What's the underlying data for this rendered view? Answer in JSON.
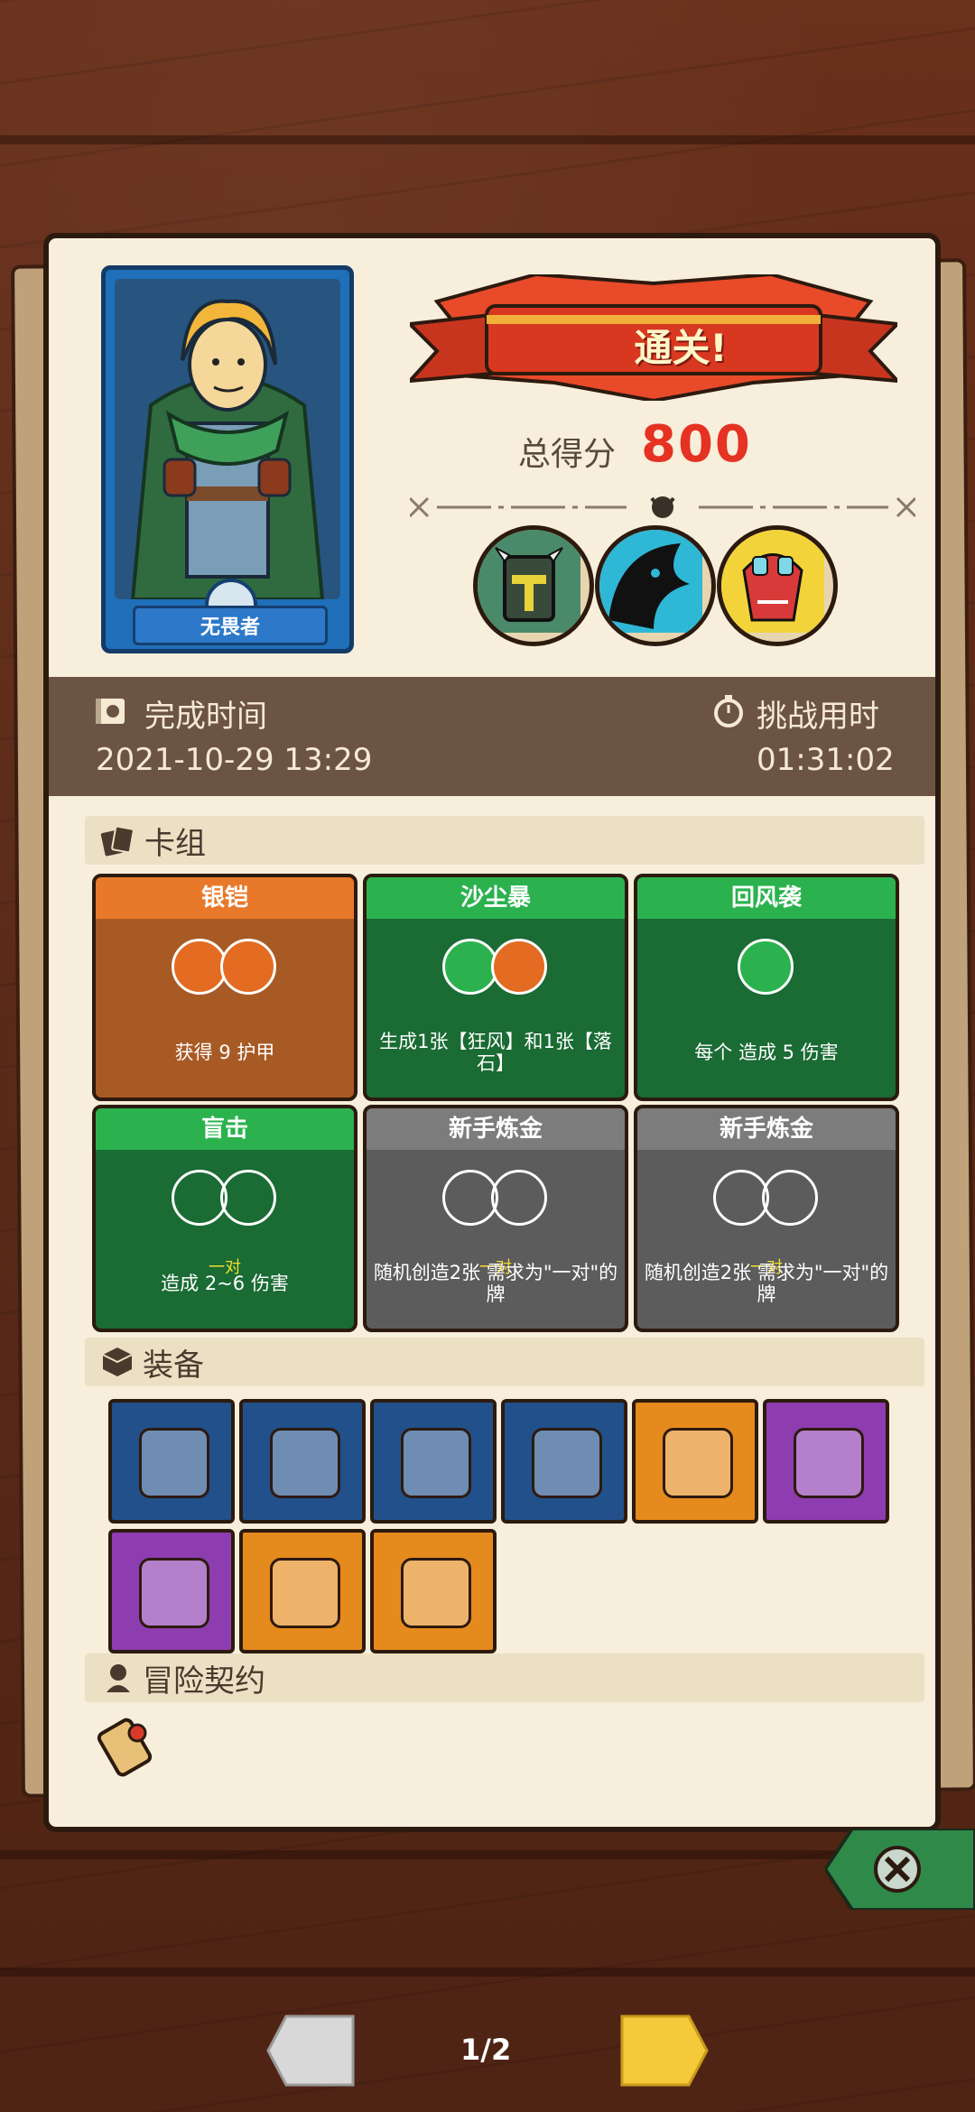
{
  "hero": {
    "name": "无畏者"
  },
  "result": {
    "banner": "通关!",
    "score_label": "总得分",
    "score": "800"
  },
  "bosses": [
    {
      "icon": "armored-knight-boss"
    },
    {
      "icon": "shadow-beast-boss"
    },
    {
      "icon": "demon-mask-boss"
    }
  ],
  "info": {
    "finish_label": "完成时间",
    "finish_value": "2021-10-29 13:29",
    "duration_label": "挑战用时",
    "duration_value": "01:31:02"
  },
  "sections": {
    "deck": "卡组",
    "equipment": "装备",
    "contract": "冒险契约"
  },
  "cards": [
    {
      "title": "银铠",
      "header_color": "#e8792a",
      "body_color": "#a85a24",
      "desc": "获得 9 护甲"
    },
    {
      "title": "沙尘暴",
      "header_color": "#2bb24f",
      "body_color": "#1a6b34",
      "desc": "生成1张【狂风】和1张【落石】"
    },
    {
      "title": "回风袭",
      "header_color": "#2bb24f",
      "body_color": "#1a6b34",
      "desc": "每个 造成 5 伤害"
    },
    {
      "title": "盲击",
      "header_color": "#2bb24f",
      "body_color": "#1a6b34",
      "pair": "一对",
      "desc": "造成 2~6 伤害"
    },
    {
      "title": "新手炼金",
      "header_color": "#7c7c7c",
      "body_color": "#5c5c5c",
      "pair": "一对",
      "desc": "随机创造2张 需求为\"一对\"的牌"
    },
    {
      "title": "新手炼金",
      "header_color": "#7c7c7c",
      "body_color": "#5c5c5c",
      "pair": "一对",
      "desc": "随机创造2张 需求为\"一对\"的牌"
    }
  ],
  "equipment": [
    {
      "icon": "chest-armor-icon",
      "bg": "#22508a"
    },
    {
      "icon": "snowflake-emblem-icon",
      "bg": "#22508a"
    },
    {
      "icon": "horn-icon",
      "bg": "#22508a"
    },
    {
      "icon": "gold-helmet-icon",
      "bg": "#22508a"
    },
    {
      "icon": "red-hood-icon",
      "bg": "#e58a1c"
    },
    {
      "icon": "flesh-cube-icon",
      "bg": "#8d3db0"
    },
    {
      "icon": "green-gem-icon",
      "bg": "#8d3db0"
    },
    {
      "icon": "shark-blade-icon",
      "bg": "#e58a1c"
    },
    {
      "icon": "triangle-sigil-icon",
      "bg": "#e58a1c"
    }
  ],
  "pagination": {
    "text": "1/2"
  }
}
